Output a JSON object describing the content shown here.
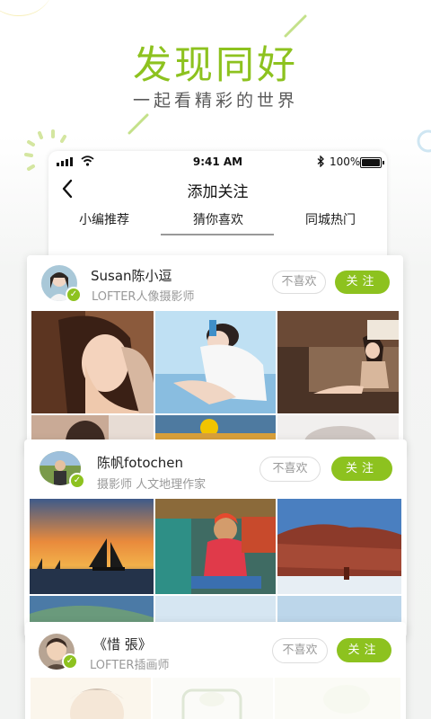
{
  "headline": "发现同好",
  "subline": "一起看精彩的世界",
  "status_bar": {
    "time": "9:41 AM",
    "battery": "100%"
  },
  "nav": {
    "title": "添加关注"
  },
  "tabs": [
    {
      "label": "小编推荐"
    },
    {
      "label": "猜你喜欢",
      "active": true
    },
    {
      "label": "同城热门"
    }
  ],
  "cards": [
    {
      "name": "Susan陈小逗",
      "description": "LOFTER人像摄影师",
      "dislike_label": "不喜欢",
      "follow_label": "关注",
      "verified": true
    },
    {
      "name": "陈帆fotochen",
      "description": "摄影师  人文地理作家",
      "dislike_label": "不喜欢",
      "follow_label": "关注",
      "verified": true
    },
    {
      "name": "《惜 張》",
      "description": "LOFTER插画师",
      "dislike_label": "不喜欢",
      "follow_label": "关注",
      "verified": true
    }
  ],
  "colors": {
    "accent": "#8dc21f",
    "text": "#222222",
    "muted": "#999999"
  }
}
